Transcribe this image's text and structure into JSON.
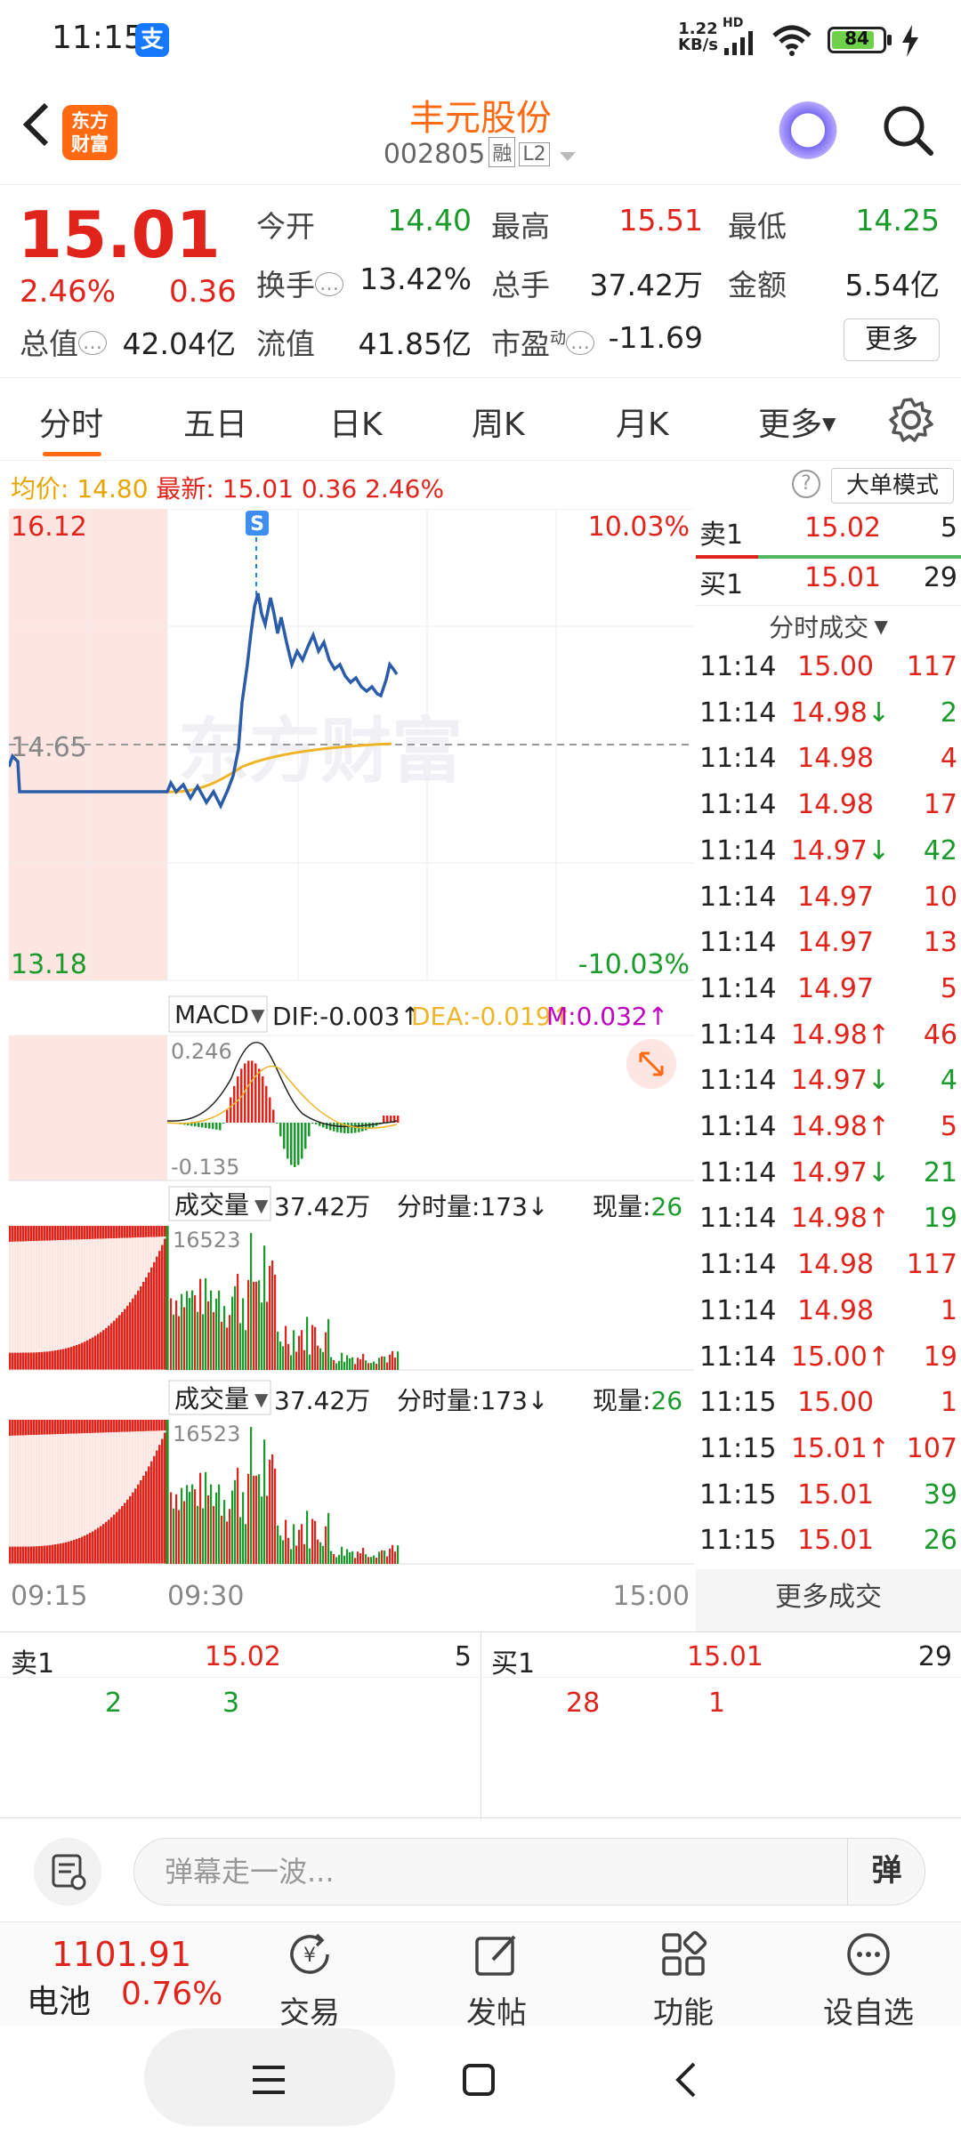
{
  "status_bar": {
    "time": "11:15",
    "app_icon": "支",
    "net_speed_top": "1.22",
    "net_speed_bottom": "KB/s",
    "hd": "HD",
    "battery": "84",
    "battery_level": 0.84
  },
  "header": {
    "logo": "东方财富",
    "title": "丰元股份",
    "code": "002805",
    "tag1": "融",
    "tag2": "L2"
  },
  "quote": {
    "price": "15.01",
    "pct": "2.46%",
    "chg": "0.36",
    "open_label": "今开",
    "open": "14.40",
    "high_label": "最高",
    "high": "15.51",
    "low_label": "最低",
    "low": "14.25",
    "turnover_label": "换手",
    "turnover": "13.42%",
    "volume_label": "总手",
    "volume": "37.42万",
    "amount_label": "金额",
    "amount": "5.54亿",
    "mktcap_label": "总值",
    "mktcap": "42.04亿",
    "float_label": "流值",
    "float": "41.85亿",
    "pe_label": "市盈",
    "pe_sup": "动",
    "pe": "-11.69",
    "more": "更多"
  },
  "tabs": [
    "分时",
    "五日",
    "日K",
    "周K",
    "月K",
    "更多"
  ],
  "avg_row": {
    "avg_label": "均价:",
    "avg": "14.80",
    "latest_label": "最新:",
    "latest": "15.01",
    "chg": "0.36",
    "pct": "2.46%",
    "mode": "大单模式"
  },
  "chart": {
    "y_max": "16.12",
    "y_min": "13.18",
    "y_mid": "14.65",
    "pct_max": "10.03%",
    "pct_min": "-10.03%",
    "marker": "S",
    "watermark": "东方财富",
    "x_start": "09:15",
    "x_open": "09:30",
    "x_end": "15:00"
  },
  "macd": {
    "label": "MACD",
    "dif": "DIF:-0.003",
    "dea": "DEA:-0.019",
    "m": "M:0.032",
    "max": "0.246",
    "min": "-0.135"
  },
  "vol1": {
    "label": "成交量",
    "total": "37.42万",
    "minute_label": "分时量:",
    "minute": "173",
    "now_label": "现量:",
    "now": "26",
    "peak": "16523"
  },
  "vol2": {
    "label": "成交量",
    "total": "37.42万",
    "minute_label": "分时量:",
    "minute": "173",
    "now_label": "现量:",
    "now": "26",
    "peak": "16523"
  },
  "order_book": {
    "sell1_label": "卖1",
    "sell1_price": "15.02",
    "sell1_vol": "5",
    "buy1_label": "买1",
    "buy1_price": "15.01",
    "buy1_vol": "29",
    "ticks_title": "分时成交",
    "ticks": [
      {
        "t": "11:14",
        "p": "15.00",
        "d": "",
        "v": "117",
        "pc": "red",
        "vc": "red"
      },
      {
        "t": "11:14",
        "p": "14.98",
        "d": "↓",
        "v": "2",
        "pc": "red",
        "vc": "green"
      },
      {
        "t": "11:14",
        "p": "14.98",
        "d": "",
        "v": "4",
        "pc": "red",
        "vc": "red"
      },
      {
        "t": "11:14",
        "p": "14.98",
        "d": "",
        "v": "17",
        "pc": "red",
        "vc": "red"
      },
      {
        "t": "11:14",
        "p": "14.97",
        "d": "↓",
        "v": "42",
        "pc": "red",
        "vc": "green"
      },
      {
        "t": "11:14",
        "p": "14.97",
        "d": "",
        "v": "10",
        "pc": "red",
        "vc": "red"
      },
      {
        "t": "11:14",
        "p": "14.97",
        "d": "",
        "v": "13",
        "pc": "red",
        "vc": "red"
      },
      {
        "t": "11:14",
        "p": "14.97",
        "d": "",
        "v": "5",
        "pc": "red",
        "vc": "red"
      },
      {
        "t": "11:14",
        "p": "14.98",
        "d": "↑",
        "v": "46",
        "pc": "red",
        "vc": "red"
      },
      {
        "t": "11:14",
        "p": "14.97",
        "d": "↓",
        "v": "4",
        "pc": "red",
        "vc": "green"
      },
      {
        "t": "11:14",
        "p": "14.98",
        "d": "↑",
        "v": "5",
        "pc": "red",
        "vc": "red"
      },
      {
        "t": "11:14",
        "p": "14.97",
        "d": "↓",
        "v": "21",
        "pc": "red",
        "vc": "green"
      },
      {
        "t": "11:14",
        "p": "14.98",
        "d": "↑",
        "v": "19",
        "pc": "red",
        "vc": "green"
      },
      {
        "t": "11:14",
        "p": "14.98",
        "d": "",
        "v": "117",
        "pc": "red",
        "vc": "red"
      },
      {
        "t": "11:14",
        "p": "14.98",
        "d": "",
        "v": "1",
        "pc": "red",
        "vc": "red"
      },
      {
        "t": "11:14",
        "p": "15.00",
        "d": "↑",
        "v": "19",
        "pc": "red",
        "vc": "red"
      },
      {
        "t": "11:15",
        "p": "15.00",
        "d": "",
        "v": "1",
        "pc": "red",
        "vc": "red"
      },
      {
        "t": "11:15",
        "p": "15.01",
        "d": "↑",
        "v": "107",
        "pc": "red",
        "vc": "red"
      },
      {
        "t": "11:15",
        "p": "15.01",
        "d": "",
        "v": "39",
        "pc": "red",
        "vc": "green"
      },
      {
        "t": "11:15",
        "p": "15.01",
        "d": "",
        "v": "26",
        "pc": "red",
        "vc": "green"
      }
    ],
    "more_ticks": "更多成交"
  },
  "depth": {
    "sell_label": "卖1",
    "sell_price": "15.02",
    "sell_vol": "5",
    "sell_a": "2",
    "sell_b": "3",
    "buy_label": "买1",
    "buy_price": "15.01",
    "buy_vol": "29",
    "buy_a": "28",
    "buy_b": "1"
  },
  "comment": {
    "placeholder": "弹幕走一波...",
    "danmu": "弹"
  },
  "bottom_nav": {
    "index_value": "1101.91",
    "index_name": "电池",
    "index_pct": "0.76%",
    "items": [
      "交易",
      "发帖",
      "功能",
      "设自选"
    ]
  },
  "colors": {
    "up": "#e0241c",
    "down": "#1a9a2a",
    "accent": "#ff6a13",
    "price_line": "#2a5caa",
    "avg_line": "#f0b429",
    "macd_m": "#c000c0"
  }
}
